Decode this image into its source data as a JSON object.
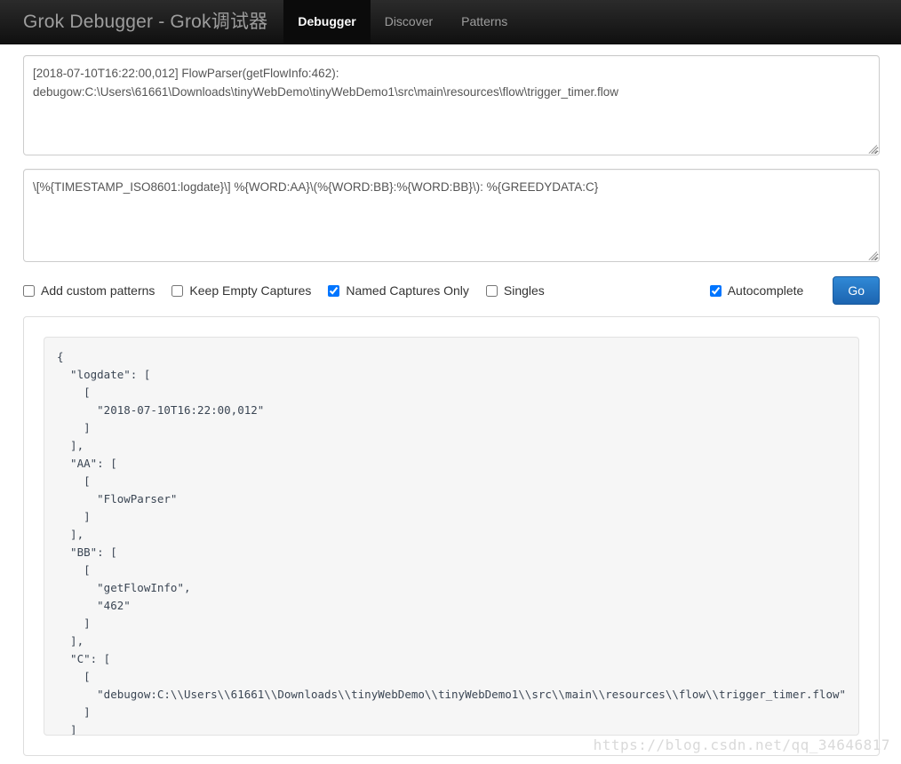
{
  "navbar": {
    "brand": "Grok Debugger - Grok调试器",
    "items": [
      {
        "label": "Debugger",
        "active": true
      },
      {
        "label": "Discover",
        "active": false
      },
      {
        "label": "Patterns",
        "active": false
      }
    ]
  },
  "input": {
    "value": "[2018-07-10T16:22:00,012] FlowParser(getFlowInfo:462):\ndebugow:C:\\Users\\61661\\Downloads\\tinyWebDemo\\tinyWebDemo1\\src\\main\\resources\\flow\\trigger_timer.flow",
    "placeholder": ""
  },
  "pattern": {
    "value": "\\[%{TIMESTAMP_ISO8601:logdate}\\] %{WORD:AA}\\(%{WORD:BB}:%{WORD:BB}\\): %{GREEDYDATA:C}",
    "placeholder": ""
  },
  "options": {
    "add_custom_patterns": {
      "label": "Add custom patterns",
      "checked": false
    },
    "keep_empty_captures": {
      "label": "Keep Empty Captures",
      "checked": false
    },
    "named_captures_only": {
      "label": "Named Captures Only",
      "checked": true
    },
    "singles": {
      "label": "Singles",
      "checked": false
    },
    "autocomplete": {
      "label": "Autocomplete",
      "checked": true
    },
    "go_button": "Go"
  },
  "output": {
    "text": "{\n  \"logdate\": [\n    [\n      \"2018-07-10T16:22:00,012\"\n    ]\n  ],\n  \"AA\": [\n    [\n      \"FlowParser\"\n    ]\n  ],\n  \"BB\": [\n    [\n      \"getFlowInfo\",\n      \"462\"\n    ]\n  ],\n  \"C\": [\n    [\n      \"debugow:C:\\\\Users\\\\61661\\\\Downloads\\\\tinyWebDemo\\\\tinyWebDemo1\\\\src\\\\main\\\\resources\\\\flow\\\\trigger_timer.flow\"\n    ]\n  ]\n}"
  },
  "watermark": "https://blog.csdn.net/qq_34646817",
  "colors": {
    "navbar_bg": "#181818",
    "navbar_active_bg": "#0b0b0b",
    "navbar_text": "#9d9d9d",
    "go_button": "#2a7fd4",
    "output_bg": "#f6f6f6",
    "output_text": "#3b4654"
  }
}
